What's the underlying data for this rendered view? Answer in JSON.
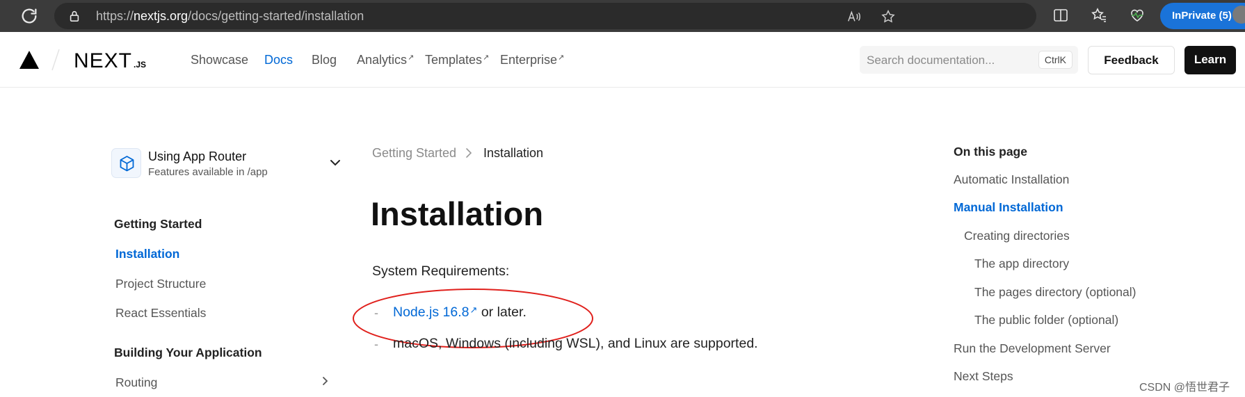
{
  "browser": {
    "url_prefix": "https://",
    "url_host": "nextjs.org",
    "url_path": "/docs/getting-started/installation",
    "inprivate_label": "InPrivate (5)",
    "icons": [
      "refresh-icon",
      "lock-icon",
      "read-aloud-icon",
      "favorite-star-icon",
      "split-screen-icon",
      "favorites-icon",
      "browser-essentials-icon"
    ]
  },
  "header": {
    "logo_text": "NEXT",
    "logo_suffix": ".JS",
    "nav": [
      {
        "label": "Showcase"
      },
      {
        "label": "Docs"
      },
      {
        "label": "Blog"
      },
      {
        "label": "Analytics"
      },
      {
        "label": "Templates"
      },
      {
        "label": "Enterprise"
      }
    ],
    "external_marker": "↗",
    "search_placeholder": "Search documentation...",
    "search_shortcut": "CtrlK",
    "feedback_label": "Feedback",
    "learn_label": "Learn"
  },
  "sidebar": {
    "router_title": "Using App Router",
    "router_subtitle": "Features available in /app",
    "sections": [
      {
        "heading": "Getting Started",
        "items": [
          {
            "label": "Installation"
          },
          {
            "label": "Project Structure"
          },
          {
            "label": "React Essentials"
          }
        ]
      },
      {
        "heading": "Building Your Application",
        "items": [
          {
            "label": "Routing"
          }
        ]
      }
    ]
  },
  "main": {
    "breadcrumb": [
      "Getting Started",
      "Installation"
    ],
    "title": "Installation",
    "requirements_label": "System Requirements:",
    "bullet_marker": "-",
    "node_link": "Node.js 16.8",
    "node_suffix": "or later.",
    "os_text": "macOS, Windows (including WSL), and Linux are supported."
  },
  "toc": {
    "heading": "On this page",
    "items": [
      {
        "label": "Automatic Installation"
      },
      {
        "label": "Manual Installation"
      },
      {
        "label": "Creating directories"
      },
      {
        "label": "The app directory"
      },
      {
        "label": "The pages directory (optional)"
      },
      {
        "label": "The public folder (optional)"
      },
      {
        "label": "Run the Development Server"
      },
      {
        "label": "Next Steps"
      }
    ]
  },
  "watermark": "CSDN @悟世君子",
  "colors": {
    "accent": "#0068d6",
    "annotation": "#e0201c",
    "browser_bar": "#3b3b3b",
    "inprivate": "#1a73d9"
  }
}
